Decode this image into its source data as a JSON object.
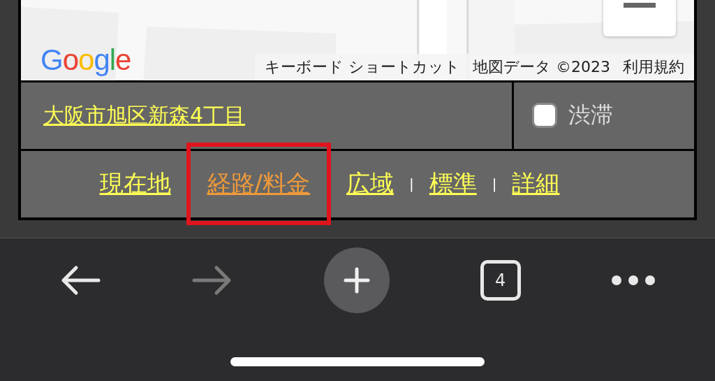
{
  "map": {
    "kind": "picture",
    "logo": "Google",
    "attribution": [
      "キーボード ショートカット",
      "地図データ ©2023",
      "利用規約"
    ]
  },
  "address": {
    "text": "大阪市旭区新森4丁目"
  },
  "traffic": {
    "label": "渋滞",
    "checked": false
  },
  "nav_links": [
    {
      "kind": "link",
      "label": "現在地",
      "selected": false
    },
    {
      "kind": "link",
      "label": "経路/料金",
      "selected": true
    },
    {
      "kind": "link",
      "label": "広域",
      "selected": false
    },
    {
      "kind": "separator",
      "label": "|"
    },
    {
      "kind": "link",
      "label": "標準",
      "selected": false
    },
    {
      "kind": "separator",
      "label": "|"
    },
    {
      "kind": "link",
      "label": "詳細",
      "selected": false
    }
  ],
  "toolbar": {
    "back_disabled": false,
    "forward_disabled": true,
    "tab_count": "4"
  }
}
